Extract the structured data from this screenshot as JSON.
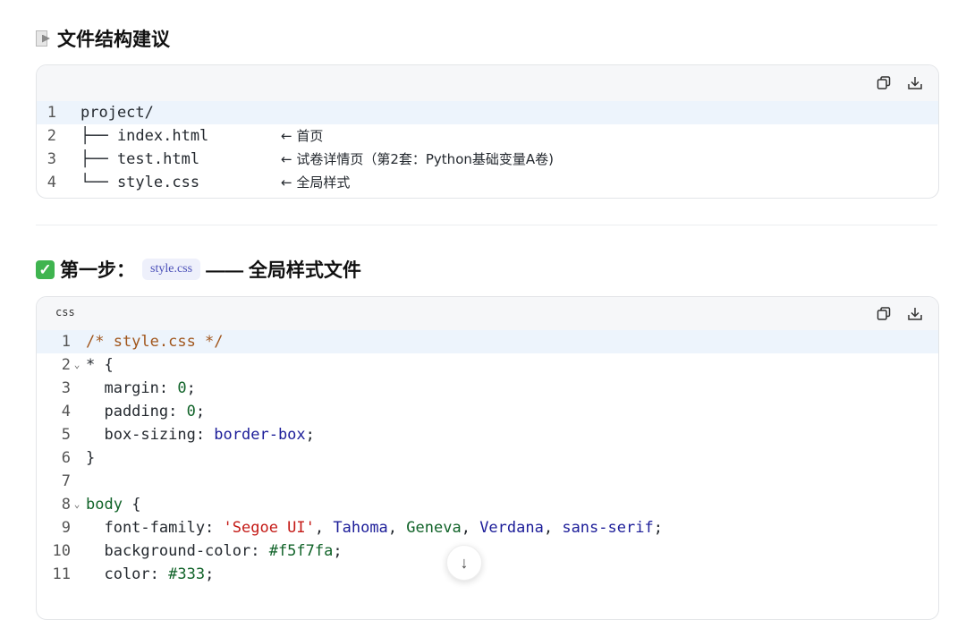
{
  "section1": {
    "heading_icon": "document-icon",
    "heading": "文件结构建议",
    "code_lines": [
      {
        "n": "1",
        "text": "project/",
        "note": ""
      },
      {
        "n": "2",
        "text": "├── index.html",
        "note": "← 首页"
      },
      {
        "n": "3",
        "text": "├── test.html",
        "note": "← 试卷详情页（第2套：Python基础变量A卷)"
      },
      {
        "n": "4",
        "text": "└── style.css",
        "note": "← 全局样式"
      }
    ]
  },
  "section2": {
    "heading_icon": "check-icon",
    "heading_prefix": "第一步：",
    "heading_code": "style.css",
    "heading_suffix": "—— 全局样式文件",
    "lang_label": "css",
    "lines": {
      "l1": "/* style.css */",
      "l2a": "* {",
      "l3a": "  margin: ",
      "l3b": "0",
      "l3c": ";",
      "l4a": "  padding: ",
      "l4b": "0",
      "l4c": ";",
      "l5a": "  box-sizing: ",
      "l5b": "border-box",
      "l5c": ";",
      "l6": "}",
      "l8a": "body",
      "l8b": " {",
      "l9a": "  font-family: ",
      "l9b": "'Segoe UI'",
      "l9c": ", ",
      "l9d": "Tahoma",
      "l9e": ", ",
      "l9f": "Geneva",
      "l9g": ", ",
      "l9h": "Verdana",
      "l9i": ", ",
      "l9j": "sans-serif",
      "l9k": ";",
      "l10a": "  background-color: ",
      "l10b": "#f5f7fa",
      "l10c": ";",
      "l11a": "  color: ",
      "l11b": "#333",
      "l11c": ";"
    }
  },
  "icons": {
    "copy": "copy-icon",
    "download": "download-icon",
    "scroll_down": "arrow-down-icon"
  },
  "scroll_button_glyph": "↓",
  "colors": {
    "comment": "#a1561c",
    "selector": "#116329",
    "number": "#116329",
    "keyword": "#1c1d99",
    "string": "#c41a16",
    "highlight_line": "#edf4fc",
    "check": "#3fb44f"
  }
}
